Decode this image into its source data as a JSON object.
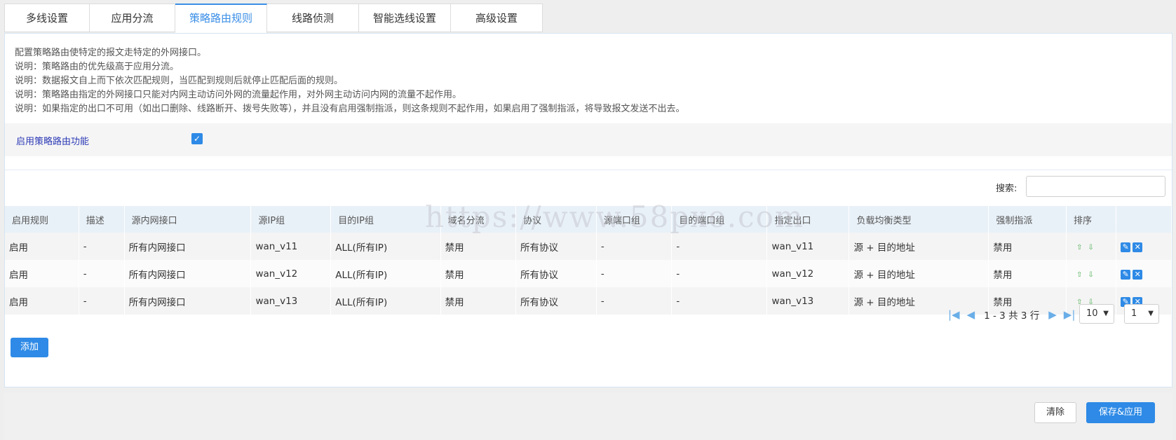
{
  "tabs": [
    {
      "label": "多线设置"
    },
    {
      "label": "应用分流"
    },
    {
      "label": "策略路由规则"
    },
    {
      "label": "线路侦测"
    },
    {
      "label": "智能选线设置"
    },
    {
      "label": "高级设置"
    }
  ],
  "active_tab": "策略路由规则",
  "notes": [
    "配置策略路由使特定的报文走特定的外网接口。",
    "说明：策略路由的优先级高于应用分流。",
    "说明：数据报文自上而下依次匹配规则，当匹配到规则后就停止匹配后面的规则。",
    "说明：策略路由指定的外网接口只能对内网主动访问外网的流量起作用，对外网主动访问内网的流量不起作用。",
    "说明：如果指定的出口不可用（如出口删除、线路断开、拨号失败等），并且没有启用强制指派，则这条规则不起作用，如果启用了强制指派，将导致报文发送不出去。"
  ],
  "enable": {
    "label": "启用策略路由功能",
    "checked": true,
    "check_mark": "✓"
  },
  "search": {
    "label": "搜索:",
    "value": ""
  },
  "table": {
    "columns": [
      "启用规则",
      "描述",
      "源内网接口",
      "源IP组",
      "目的IP组",
      "域名分流",
      "协议",
      "源端口组",
      "目的端口组",
      "指定出口",
      "负载均衡类型",
      "强制指派",
      "排序",
      ""
    ],
    "rows": [
      {
        "enabled": "启用",
        "desc": "-",
        "src_if": "所有内网接口",
        "src_ip": "wan_v11",
        "dst_ip": "ALL(所有IP)",
        "domain": "禁用",
        "proto": "所有协议",
        "src_port": "-",
        "dst_port": "-",
        "out": "wan_v11",
        "lb": "源 + 目的地址",
        "force": "禁用"
      },
      {
        "enabled": "启用",
        "desc": "-",
        "src_if": "所有内网接口",
        "src_ip": "wan_v12",
        "dst_ip": "ALL(所有IP)",
        "domain": "禁用",
        "proto": "所有协议",
        "src_port": "-",
        "dst_port": "-",
        "out": "wan_v12",
        "lb": "源 + 目的地址",
        "force": "禁用"
      },
      {
        "enabled": "启用",
        "desc": "-",
        "src_if": "所有内网接口",
        "src_ip": "wan_v13",
        "dst_ip": "ALL(所有IP)",
        "domain": "禁用",
        "proto": "所有协议",
        "src_port": "-",
        "dst_port": "-",
        "out": "wan_v13",
        "lb": "源 + 目的地址",
        "force": "禁用"
      }
    ]
  },
  "pager": {
    "summary": "1 - 3 共 3 行",
    "page_size": "10",
    "page": "1",
    "first": "|◀",
    "prev": "◀",
    "next": "▶",
    "last": "▶|",
    "dropdown_arrow": "▼"
  },
  "icons": {
    "sort_up": "⇧",
    "sort_down": "⇩",
    "edit": "✎",
    "delete": "✕"
  },
  "add_button": "添加",
  "footer": {
    "clear": "清除",
    "save": "保存&应用"
  },
  "watermark": "https://www.58pxe.com",
  "colors": {
    "accent": "#2e8ae6",
    "tab_active": "#3a8ee6",
    "header_bg": "#e9f1f8"
  }
}
